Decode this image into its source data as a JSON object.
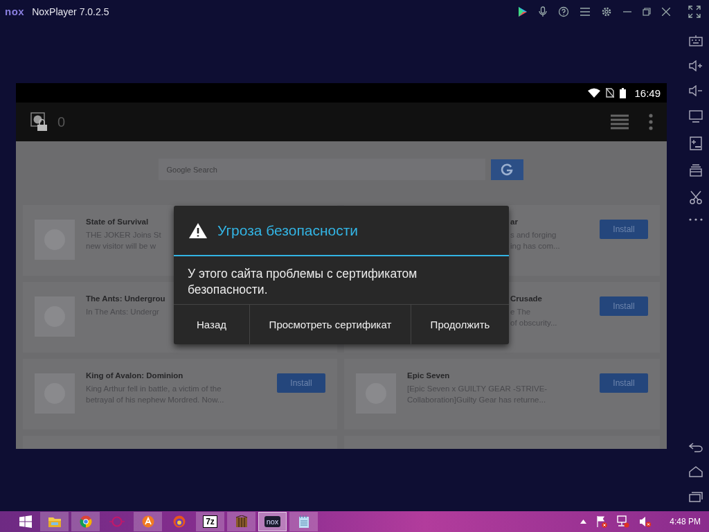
{
  "window": {
    "logo": "nox",
    "title": "NoxPlayer 7.0.2.5"
  },
  "android": {
    "time": "16:49",
    "count": "0",
    "search": {
      "placeholder": "Google Search"
    },
    "cards": [
      {
        "kind": "app",
        "covered": false,
        "title": "State of Survival",
        "lines": [
          "THE JOKER Joins St",
          "new visitor will be w"
        ]
      },
      {
        "kind": "app",
        "covered": true,
        "title": "ar",
        "lines": [
          "s and forging",
          "ing has com..."
        ],
        "button": "Install"
      },
      {
        "kind": "app",
        "covered": false,
        "title": "The Ants: Undergrou",
        "lines": [
          "In The Ants: Undergr"
        ]
      },
      {
        "kind": "app",
        "covered": true,
        "title": "Crusade",
        "lines": [
          "e The",
          "of obscurity..."
        ],
        "button": "Install"
      },
      {
        "kind": "app",
        "covered": false,
        "title": "King of Avalon: Dominion",
        "lines": [
          "King Arthur fell in battle, a victim of the",
          "betrayal of his nephew Mordred. Now..."
        ],
        "button": "Install"
      },
      {
        "kind": "app",
        "covered": false,
        "title": "Epic Seven",
        "lines": [
          "[Epic Seven x GUILTY GEAR -STRIVE-",
          "Collaboration]Guilty Gear has returne..."
        ],
        "button": "Install"
      },
      {
        "kind": "blank"
      },
      {
        "kind": "blank"
      }
    ],
    "dialog": {
      "title": "Угроза безопасности",
      "message": "У этого сайта проблемы с сертификатом безопасности.",
      "buttons": [
        "Назад",
        "Просмотреть сертификат",
        "Продолжить"
      ]
    }
  },
  "taskbar": {
    "apps": [
      {
        "kind": "folder",
        "running": true
      },
      {
        "kind": "chrome",
        "running": true
      },
      {
        "kind": "ring",
        "running": false
      },
      {
        "kind": "orange",
        "running": true
      },
      {
        "kind": "fox",
        "running": false
      },
      {
        "kind": "archive",
        "running": true,
        "label": "7z"
      },
      {
        "kind": "crate",
        "running": true
      },
      {
        "kind": "nox",
        "running": true,
        "active": true,
        "label": "nox"
      },
      {
        "kind": "notepad",
        "running": true
      }
    ],
    "clock": "4:48 PM"
  }
}
